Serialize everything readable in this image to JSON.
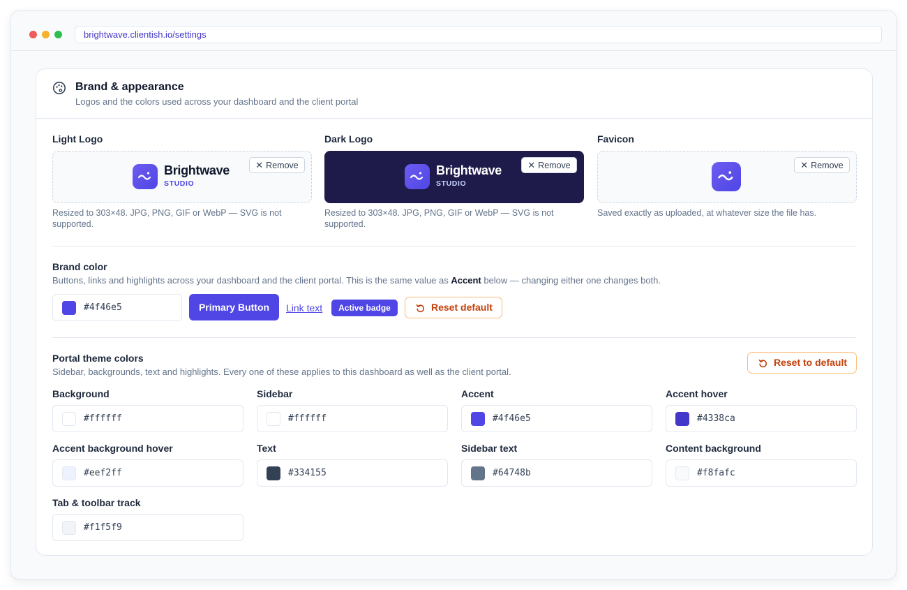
{
  "browser": {
    "url": "brightwave.clientish.io/settings"
  },
  "card": {
    "title": "Brand & appearance",
    "subtitle": "Logos and the colors used across your dashboard and the client portal"
  },
  "logos": [
    {
      "label": "Light Logo",
      "remove": "Remove",
      "wordmark": "Brightwave",
      "tagline": "STUDIO",
      "help": "Resized to 303×48. JPG, PNG, GIF or WebP — SVG is not supported."
    },
    {
      "label": "Dark Logo",
      "remove": "Remove",
      "wordmark": "Brightwave",
      "tagline": "STUDIO",
      "help": "Resized to 303×48. JPG, PNG, GIF or WebP — SVG is not supported."
    },
    {
      "label": "Favicon",
      "remove": "Remove",
      "help": "Saved exactly as uploaded, at whatever size the file has."
    }
  ],
  "brand_color": {
    "title": "Brand color",
    "desc_before": "Buttons, links and highlights across your dashboard and the client portal. This is the same value as ",
    "desc_bold": "Accent",
    "desc_after": " below — changing either one changes both.",
    "value": "#4f46e5",
    "preview_button": "Primary Button",
    "preview_link": "Link text",
    "preview_badge": "Active badge",
    "reset": "Reset default"
  },
  "portal_theme": {
    "title": "Portal theme colors",
    "desc": "Sidebar, backgrounds, text and highlights. Every one of these applies to this dashboard as well as the client portal.",
    "reset": "Reset to default",
    "fields": [
      {
        "label": "Background",
        "value": "#ffffff"
      },
      {
        "label": "Sidebar",
        "value": "#ffffff"
      },
      {
        "label": "Accent",
        "value": "#4f46e5"
      },
      {
        "label": "Accent hover",
        "value": "#4338ca"
      },
      {
        "label": "Accent background hover",
        "value": "#eef2ff"
      },
      {
        "label": "Text",
        "value": "#334155"
      },
      {
        "label": "Sidebar text",
        "value": "#64748b"
      },
      {
        "label": "Content background",
        "value": "#f8fafc"
      },
      {
        "label": "Tab & toolbar track",
        "value": "#f1f5f9"
      }
    ]
  },
  "colors": {
    "accent": "#4f46e5",
    "reset_orange": "#c2410c",
    "dark_logo_bg": "#1e1b4b"
  }
}
